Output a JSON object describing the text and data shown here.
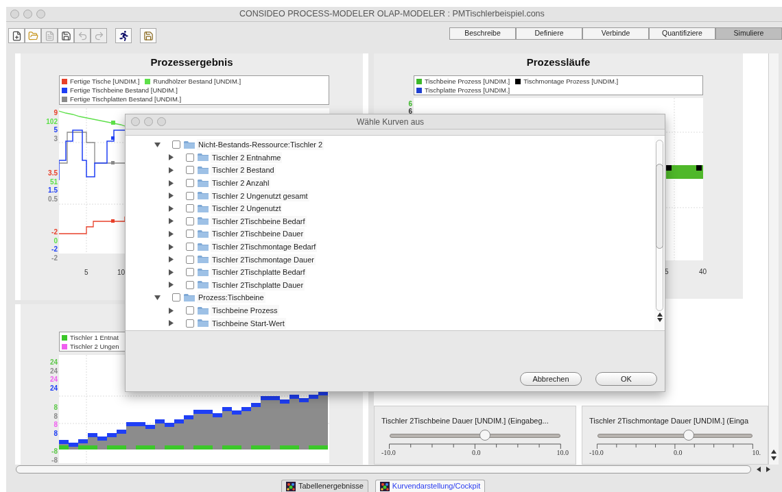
{
  "window": {
    "title": "CONSIDEO PROCESS-MODELER OLAP-MODELER : PMTischlerbeispiel.cons"
  },
  "toolbar": [
    {
      "kind": "new",
      "disabled": false
    },
    {
      "kind": "open",
      "disabled": false
    },
    {
      "kind": "document",
      "disabled": true
    },
    {
      "kind": "save",
      "disabled": false
    },
    {
      "kind": "undo",
      "disabled": true
    },
    {
      "kind": "redo",
      "disabled": true
    },
    {
      "kind": "run",
      "disabled": false
    },
    {
      "kind": "save-as",
      "disabled": false
    }
  ],
  "view_tabs": [
    {
      "label": "Beschreibe",
      "selected": false
    },
    {
      "label": "Definiere",
      "selected": false
    },
    {
      "label": "Verbinde",
      "selected": false
    },
    {
      "label": "Quantifiziere",
      "selected": false
    },
    {
      "label": "Simuliere",
      "selected": true
    }
  ],
  "process_result": {
    "title": "Prozessergebnis",
    "legend": [
      {
        "label": "Fertige Tische [UNDIM.]",
        "color": "#e8402a"
      },
      {
        "label": "Rundhölzer Bestand [UNDIM.]",
        "color": "#5ee04a"
      },
      {
        "label": "Fertige Tischbeine Bestand [UNDIM.]",
        "color": "#1f3ff5"
      },
      {
        "label": "Fertige Tischplatten Bestand [UNDIM.]",
        "color": "#8a8a8a"
      }
    ],
    "y_ticks": [
      {
        "label": "9",
        "color": "#e8402a"
      },
      {
        "label": "102",
        "color": "#5ee04a"
      },
      {
        "label": "5",
        "color": "#1f3ff5"
      },
      {
        "label": "3",
        "color": "#8a8a8a"
      },
      {
        "label": "3.5",
        "color": "#e8402a"
      },
      {
        "label": "51",
        "color": "#5ee04a"
      },
      {
        "label": "1.5",
        "color": "#1f3ff5"
      },
      {
        "label": "0.5",
        "color": "#8a8a8a"
      },
      {
        "label": "-2",
        "color": "#e8402a"
      },
      {
        "label": "0",
        "color": "#5ee04a"
      },
      {
        "label": "-2",
        "color": "#1f3ff5"
      },
      {
        "label": "-2",
        "color": "#8a8a8a"
      }
    ],
    "x_ticks": [
      "5",
      "10"
    ]
  },
  "process_runs": {
    "title": "Prozessläufe",
    "legend": [
      {
        "label": "Tischbeine Prozess [UNDIM.]",
        "color": "#3cb82a"
      },
      {
        "label": "Tischmontage Prozess [UNDIM.]",
        "color": "#000000"
      },
      {
        "label": "Tischplatte Prozess [UNDIM.]",
        "color": "#1f3fd0"
      }
    ],
    "y_ticks": [
      {
        "label": "6",
        "color": "#3cb82a"
      },
      {
        "label": "6",
        "color": "#333333"
      }
    ],
    "x_ticks": [
      "5",
      "40"
    ]
  },
  "stock_chart": {
    "legend": [
      {
        "label": "Tischler 1 Entnat",
        "color": "#3cc82a"
      },
      {
        "label": "Tischler 2 Ungen",
        "color": "#f060f0"
      }
    ],
    "y_ticks": [
      {
        "label": "24",
        "color": "#5ec84a"
      },
      {
        "label": "24",
        "color": "#8a8a8a"
      },
      {
        "label": "24",
        "color": "#f060f0"
      },
      {
        "label": "24",
        "color": "#1f3ff5"
      },
      {
        "label": "8",
        "color": "#5ec84a"
      },
      {
        "label": "8",
        "color": "#8a8a8a"
      },
      {
        "label": "8",
        "color": "#f060f0"
      },
      {
        "label": "8",
        "color": "#1f3ff5"
      },
      {
        "label": "-8",
        "color": "#5ec84a"
      },
      {
        "label": "-8",
        "color": "#8a8a8a"
      }
    ]
  },
  "sliders": [
    {
      "title": "Tischler 2Tischbeine Dauer [UNDIM.] (Eingabeg...",
      "level": 0.56,
      "scale": [
        "-10.0",
        "0.0",
        "10.0"
      ]
    },
    {
      "title": "Tischler 2Tischmontage Dauer [UNDIM.] (Einga",
      "level": 0.59,
      "scale": [
        "-10.0",
        "0.0",
        "10."
      ]
    }
  ],
  "bottom_tabs": [
    {
      "label": "Tabellenergebnisse",
      "selected": false
    },
    {
      "label": "Kurvendarstellung/Cockpit",
      "selected": true
    }
  ],
  "dialog": {
    "title": "Wähle Kurven aus",
    "tree": [
      {
        "label": "Nicht-Bestands-Ressource:Tischler 2",
        "expanded": true,
        "checked": false,
        "children": [
          {
            "label": "Tischler 2 Entnahme",
            "expanded": false,
            "checked": false
          },
          {
            "label": "Tischler 2 Bestand",
            "expanded": false,
            "checked": false
          },
          {
            "label": "Tischler 2 Anzahl",
            "expanded": false,
            "checked": false
          },
          {
            "label": "Tischler 2 Ungenutzt gesamt",
            "expanded": false,
            "checked": false
          },
          {
            "label": "Tischler 2 Ungenutzt",
            "expanded": false,
            "checked": false
          },
          {
            "label": "Tischler 2Tischbeine Bedarf",
            "expanded": false,
            "checked": false
          },
          {
            "label": "Tischler 2Tischbeine Dauer",
            "expanded": false,
            "checked": false
          },
          {
            "label": "Tischler 2Tischmontage Bedarf",
            "expanded": false,
            "checked": false
          },
          {
            "label": "Tischler 2Tischmontage Dauer",
            "expanded": false,
            "checked": false
          },
          {
            "label": "Tischler 2Tischplatte Bedarf",
            "expanded": false,
            "checked": false
          },
          {
            "label": "Tischler 2Tischplatte Dauer",
            "expanded": false,
            "checked": false
          }
        ]
      },
      {
        "label": "Prozess:Tischbeine",
        "expanded": true,
        "checked": false,
        "children": [
          {
            "label": "Tischbeine Prozess",
            "expanded": false,
            "checked": false
          },
          {
            "label": "Tischbeine Start-Wert",
            "expanded": false,
            "checked": false
          }
        ]
      }
    ],
    "buttons": [
      "Abbrechen",
      "OK"
    ]
  }
}
